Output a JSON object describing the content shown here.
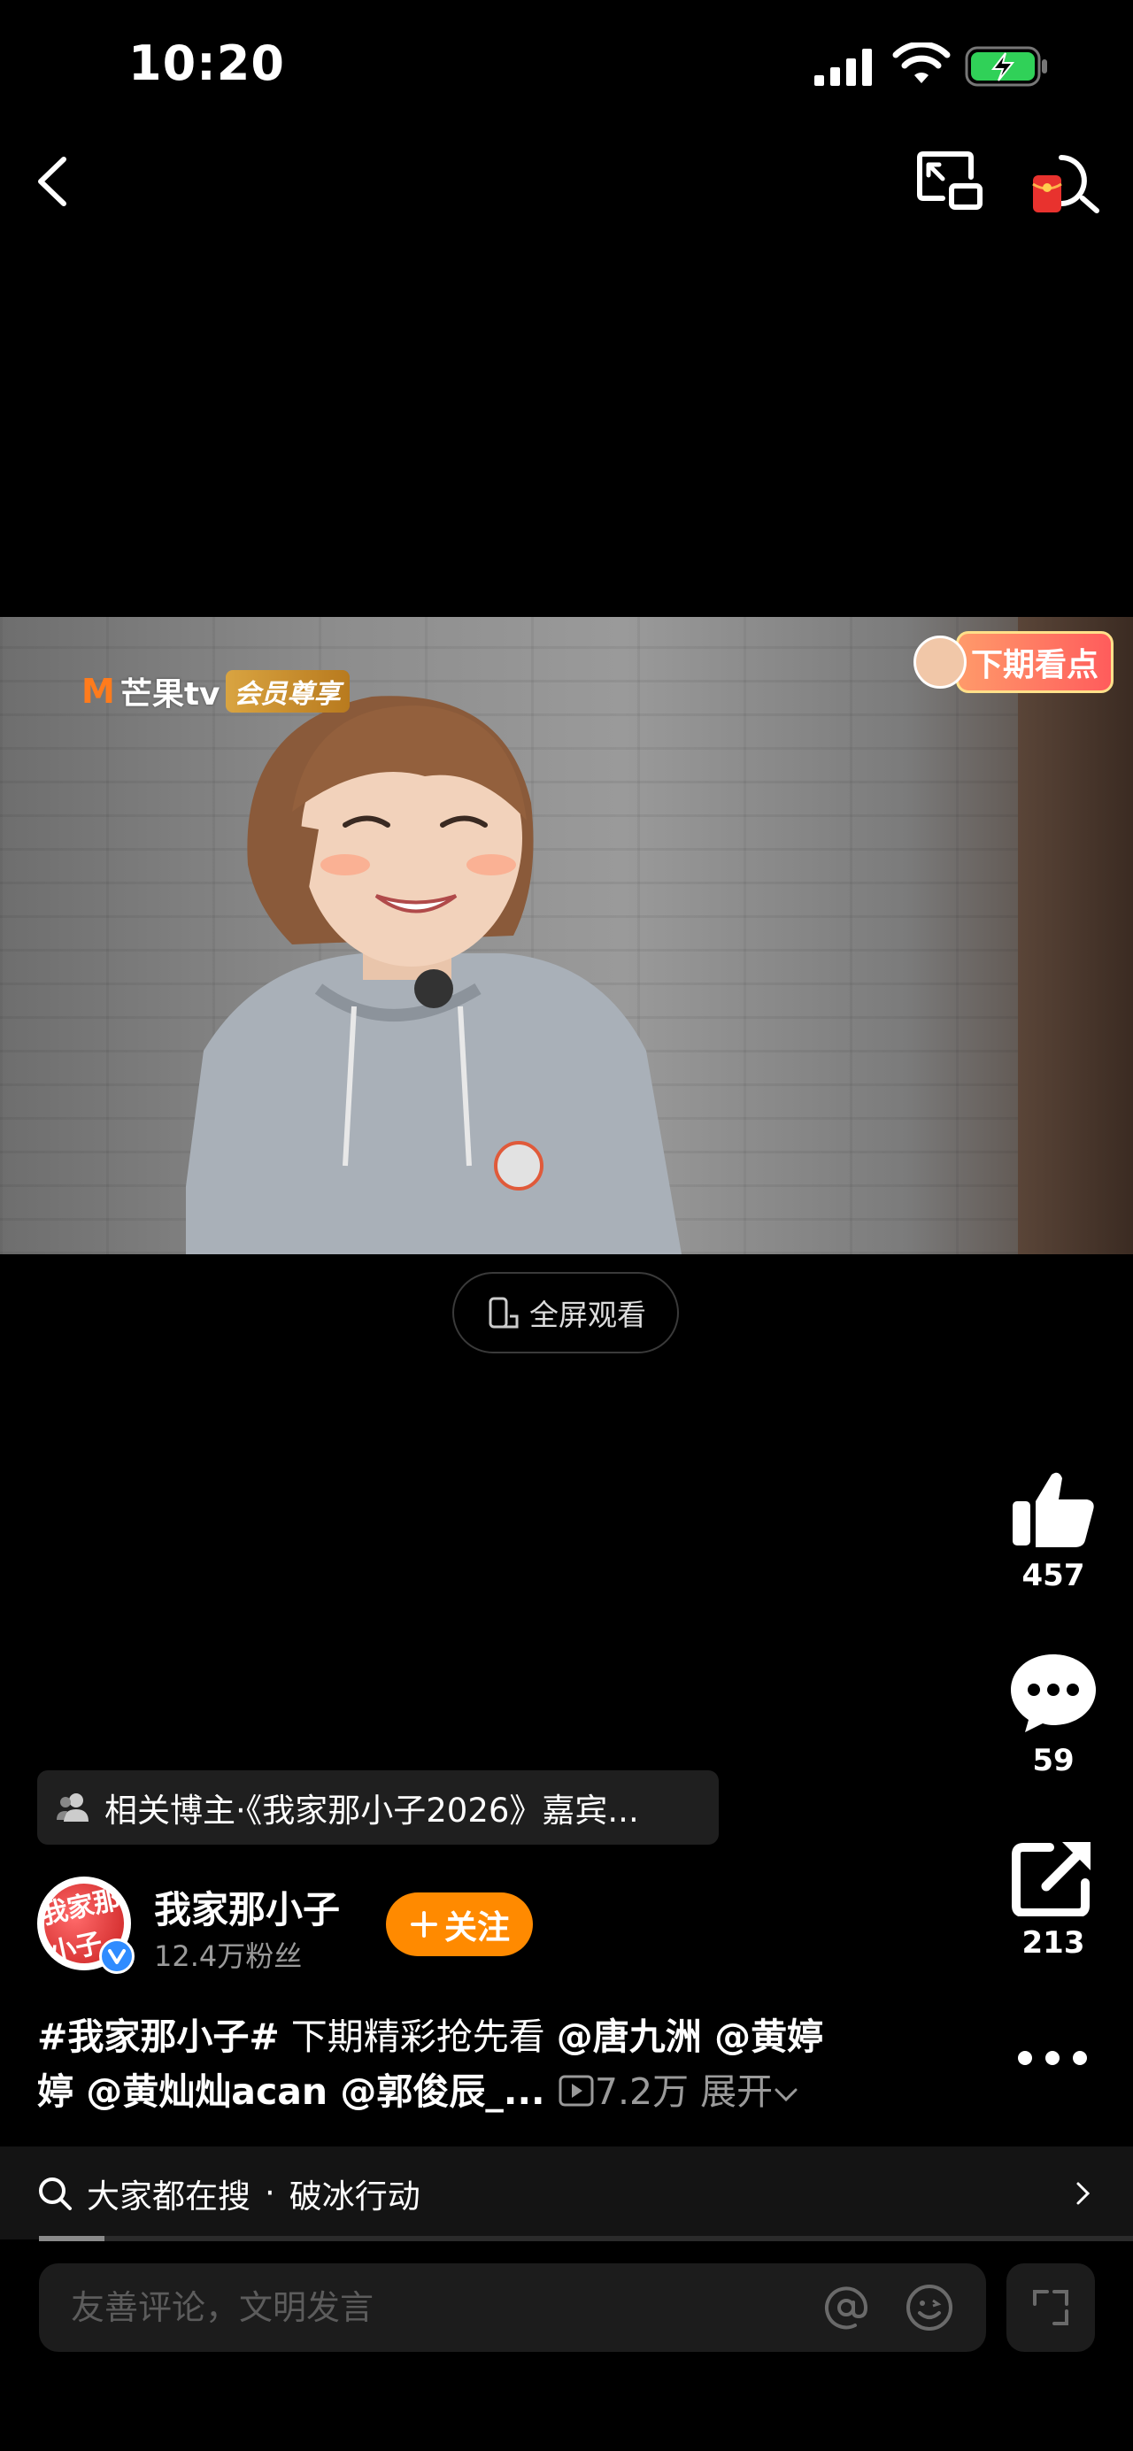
{
  "status_bar": {
    "time": "10:20"
  },
  "video": {
    "channel_logo": "芒果tv",
    "logo_mark": "M",
    "vip_badge": "会员尊享",
    "preview_badge": "下期看点",
    "fullscreen_label": "全屏观看"
  },
  "actions": {
    "like_count": "457",
    "comment_count": "59",
    "share_count": "213"
  },
  "related": {
    "label": "相关博主·《我家那小子2026》嘉宾..."
  },
  "author": {
    "name": "我家那小子",
    "fans": "12.4万粉丝",
    "follow_label": "关注",
    "avatar_text": "我家那小子"
  },
  "caption": {
    "hashtag": "#我家那小子#",
    "text": " 下期精彩抢先看 ",
    "mentions_line1": "@唐九洲 @黄婷",
    "mentions_line2": "婷 @黄灿灿acan @郭俊辰_...",
    "views": "7.2万",
    "expand_label": "展开"
  },
  "search": {
    "prefix": "大家都在搜",
    "separator": "·",
    "query": "破冰行动",
    "progress": 0.06
  },
  "comment_input": {
    "placeholder": "友善评论，文明发言"
  },
  "colors": {
    "accent": "#ff8a00",
    "verified": "#2f8cff",
    "background": "#000000"
  }
}
